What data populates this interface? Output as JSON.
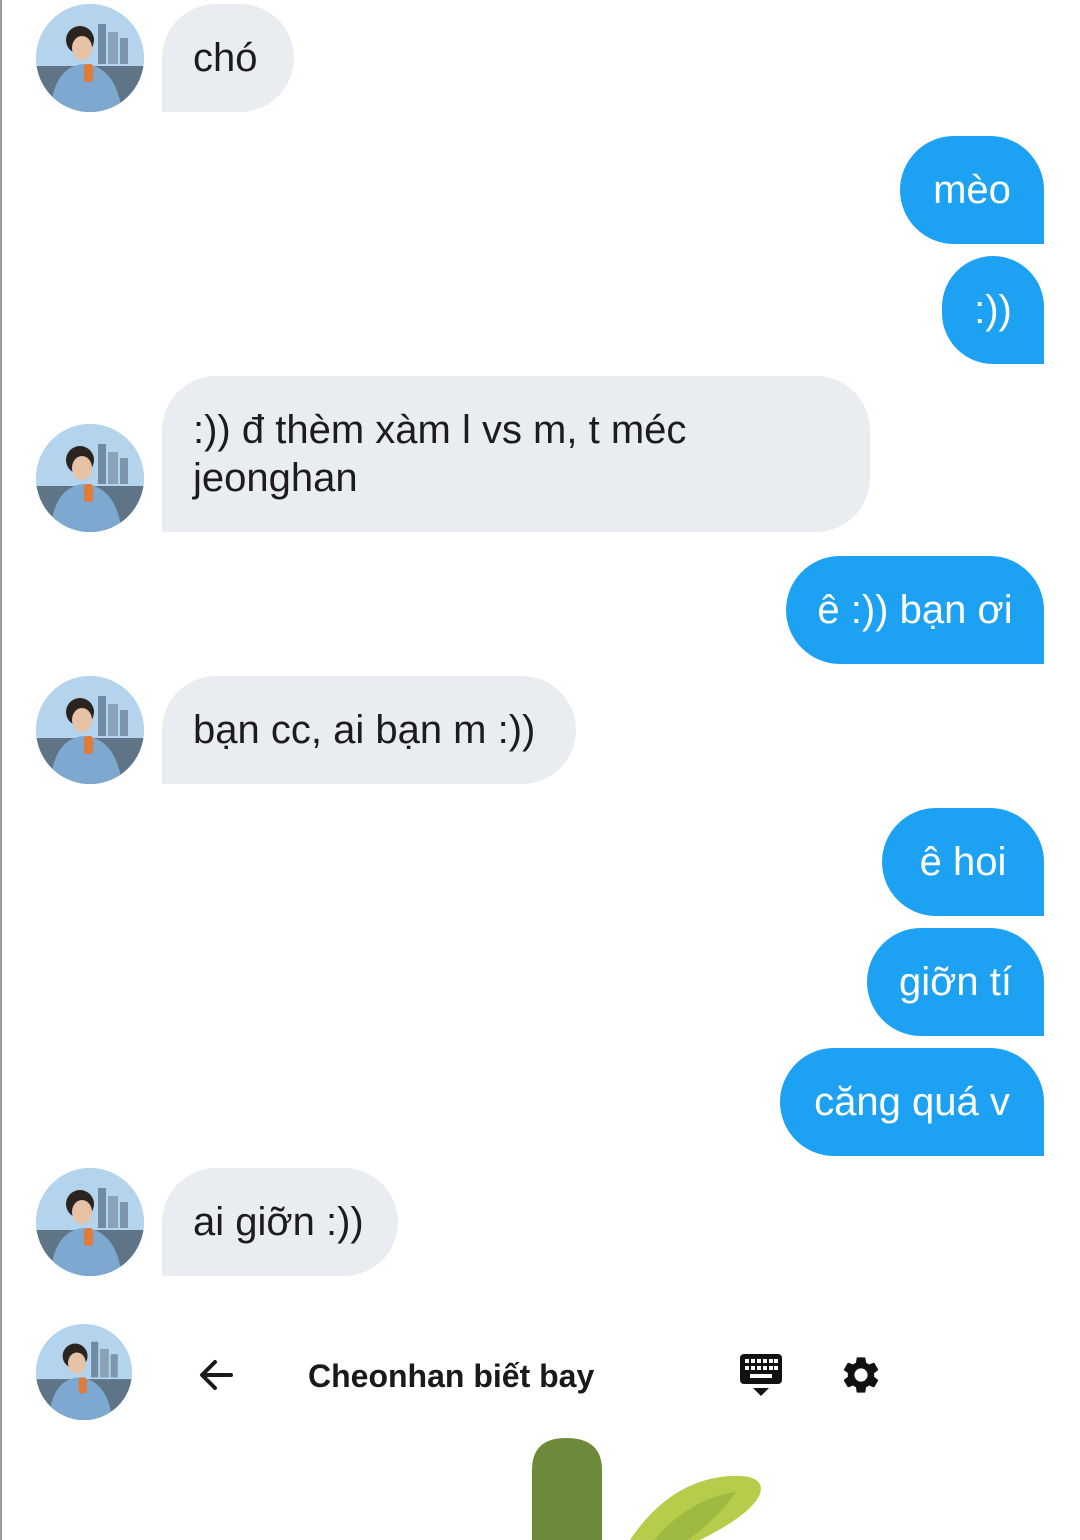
{
  "colors": {
    "incoming_bubble": "#e9edf2",
    "outgoing_bubble": "#1da1f2",
    "incoming_text": "#1c1c1c",
    "outgoing_text": "#ffffff"
  },
  "messages": [
    {
      "direction": "incoming",
      "text": "chó"
    },
    {
      "direction": "outgoing",
      "text": "mèo"
    },
    {
      "direction": "outgoing",
      "text": ":))"
    },
    {
      "direction": "incoming",
      "text": ":)) đ thèm xàm l vs m, t méc\njeonghan"
    },
    {
      "direction": "outgoing",
      "text": "ê :)) bạn ơi"
    },
    {
      "direction": "incoming",
      "text": "bạn cc, ai bạn m :))"
    },
    {
      "direction": "outgoing",
      "text": "ê hoi"
    },
    {
      "direction": "outgoing",
      "text": "giỡn tí"
    },
    {
      "direction": "outgoing",
      "text": "căng quá v"
    },
    {
      "direction": "incoming",
      "text": "ai giỡn :))"
    }
  ],
  "header": {
    "contact_name": "Cheonhan biết bay",
    "back_icon": "arrow-left-icon",
    "keyboard_icon": "keyboard-hide-icon",
    "settings_icon": "gear-icon"
  }
}
